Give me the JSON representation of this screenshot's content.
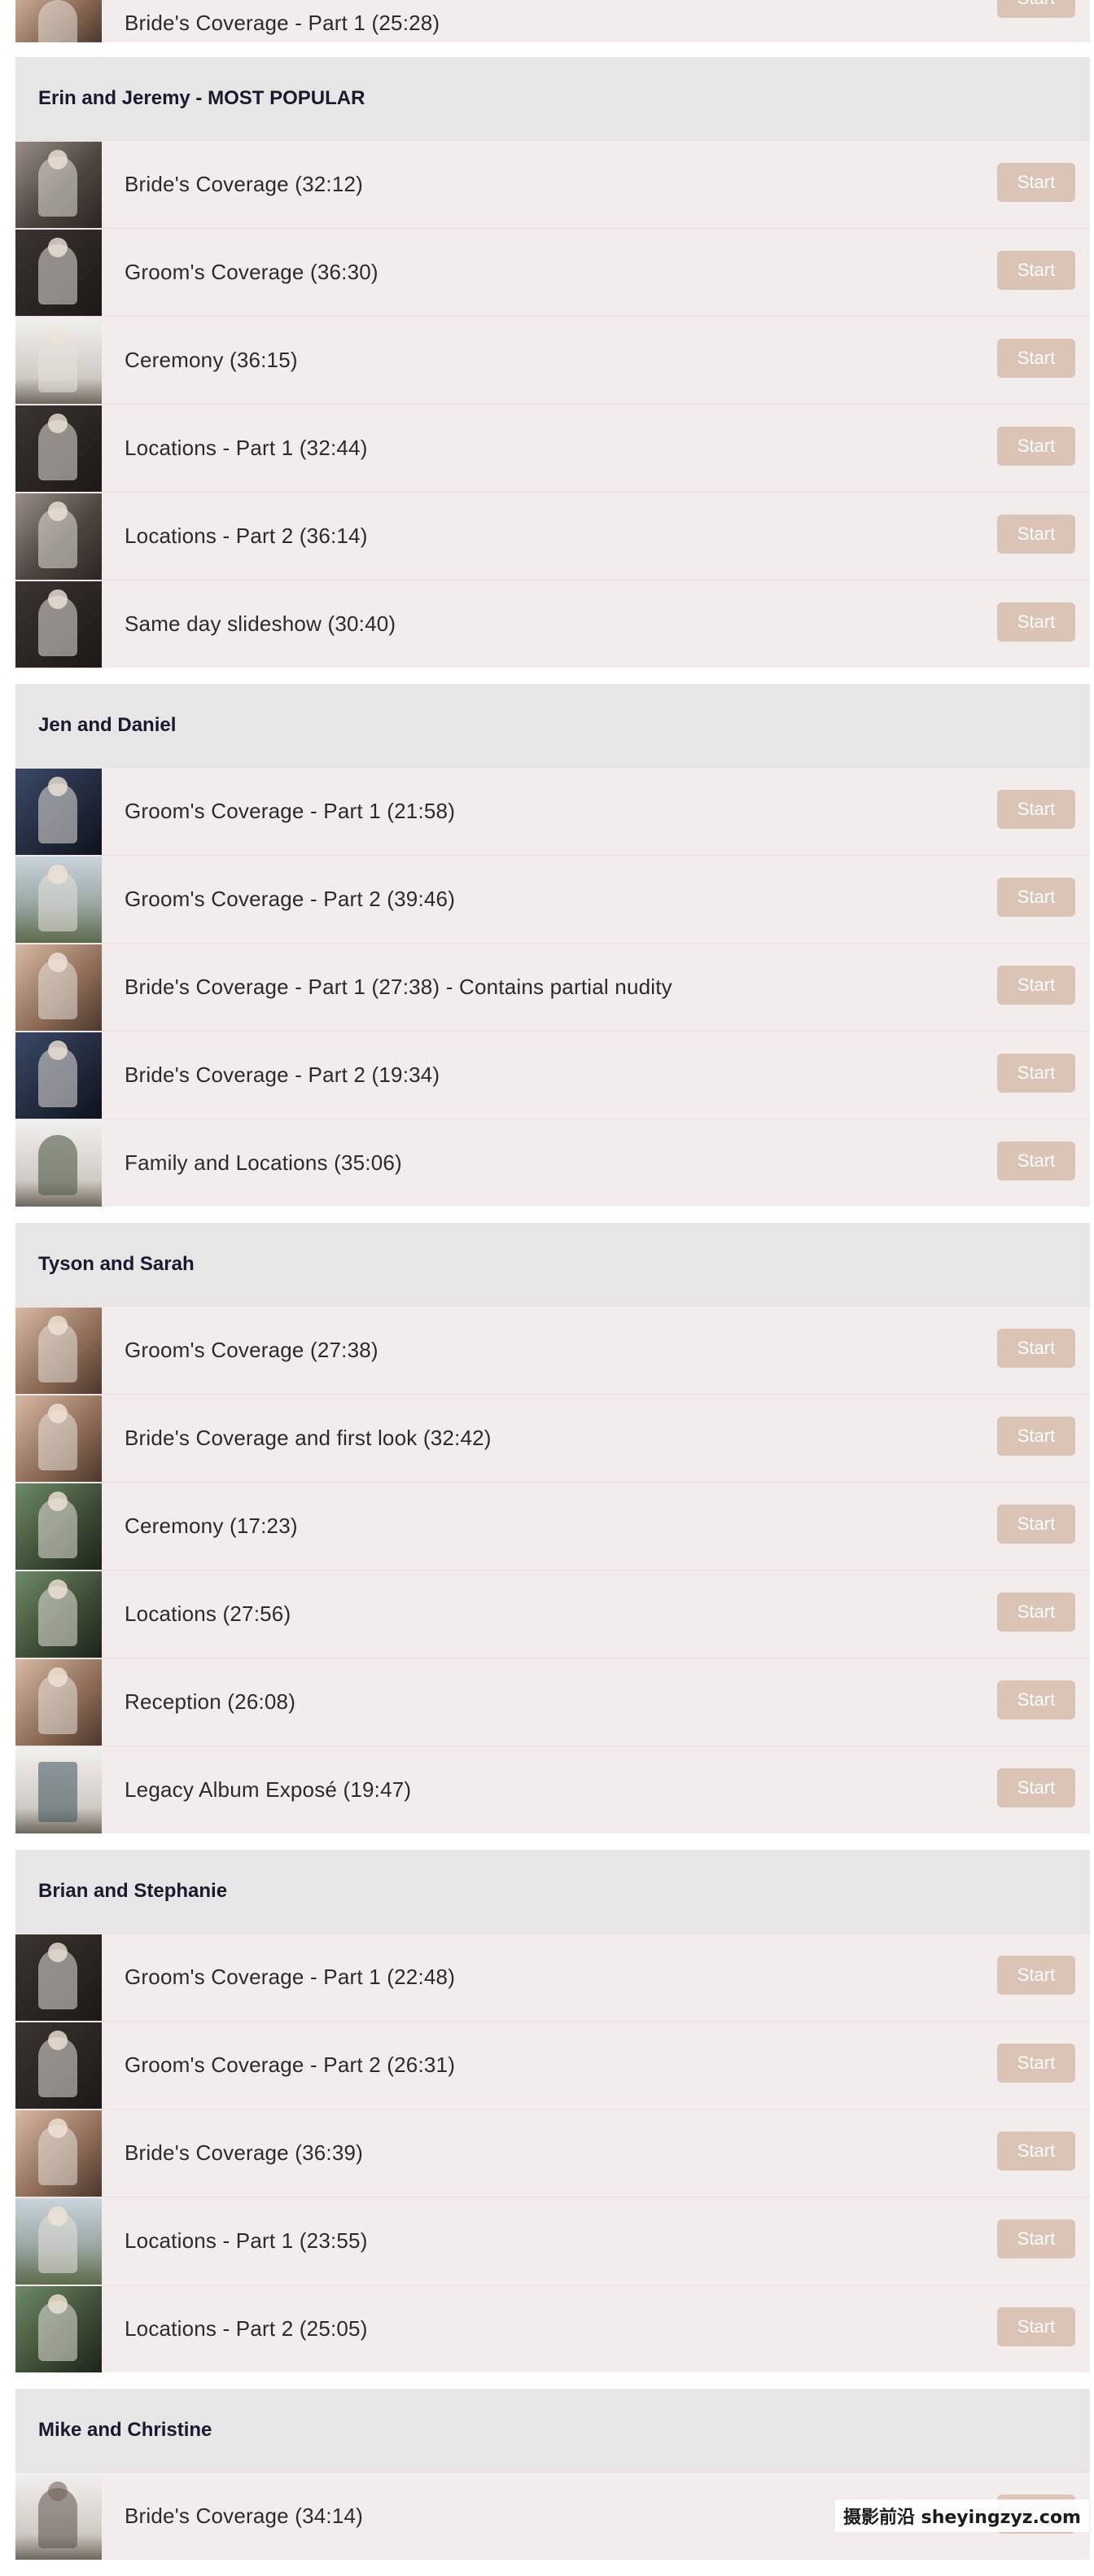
{
  "start_label": "Start",
  "top_partial": {
    "label": "Bride's Coverage - Part 1 (25:28)"
  },
  "sections": [
    {
      "title": "Erin and Jeremy - MOST POPULAR",
      "items": [
        "Bride's Coverage (32:12)",
        "Groom's Coverage (36:30)",
        "Ceremony (36:15)",
        "Locations - Part 1 (32:44)",
        "Locations - Part 2 (36:14)",
        "Same day slideshow (30:40)"
      ]
    },
    {
      "title": "Jen and Daniel",
      "items": [
        "Groom's Coverage - Part 1 (21:58)",
        "Groom's Coverage - Part 2 (39:46)",
        "Bride's Coverage - Part 1 (27:38) - Contains partial nudity",
        "Bride's Coverage - Part 2 (19:34)",
        "Family and Locations (35:06)"
      ]
    },
    {
      "title": "Tyson and Sarah",
      "items": [
        "Groom's Coverage (27:38)",
        "Bride's Coverage and first look (32:42)",
        "Ceremony (17:23)",
        "Locations (27:56)",
        "Reception (26:08)",
        "Legacy Album Exposé (19:47)"
      ]
    },
    {
      "title": "Brian and Stephanie",
      "items": [
        "Groom's Coverage - Part 1 (22:48)",
        "Groom's Coverage - Part 2 (26:31)",
        "Bride's Coverage (36:39)",
        "Locations - Part 1 (23:55)",
        "Locations - Part 2 (25:05)"
      ]
    },
    {
      "title": "Mike and Christine",
      "items": [
        "Bride's Coverage (34:14)"
      ]
    }
  ],
  "watermark": "摄影前沿 sheyingzyz.com",
  "colors": {
    "header_bg": "#e7e5e6",
    "row_bg": "#f3ecec",
    "button_bg": "#dbc3b6"
  }
}
